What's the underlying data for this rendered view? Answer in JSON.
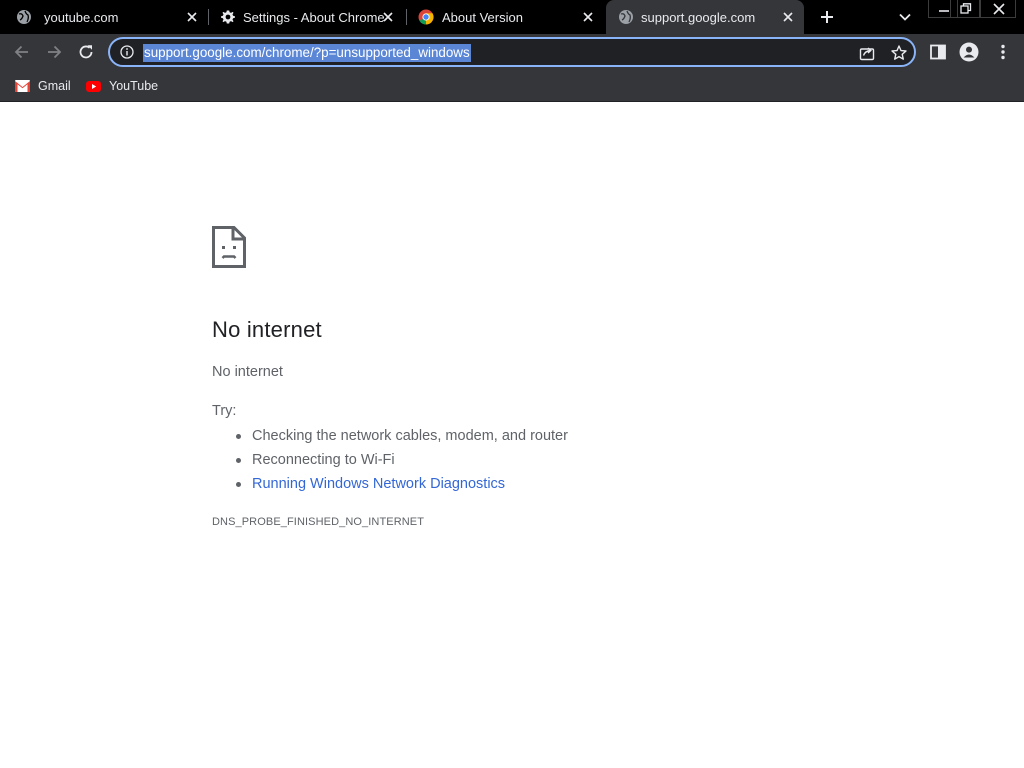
{
  "tabs": [
    {
      "title": "youtube.com",
      "favicon": "globe-icon",
      "active": false
    },
    {
      "title": "Settings - About Chrome",
      "favicon": "gear-icon",
      "active": false
    },
    {
      "title": "About Version",
      "favicon": "chrome-icon",
      "active": false
    },
    {
      "title": "support.google.com",
      "favicon": "globe-icon",
      "active": true
    }
  ],
  "omnibox": {
    "url": "support.google.com/chrome/?p=unsupported_windows"
  },
  "bookmarks": [
    {
      "label": "Gmail",
      "icon": "gmail-icon"
    },
    {
      "label": "YouTube",
      "icon": "youtube-icon"
    }
  ],
  "error_page": {
    "heading": "No internet",
    "subtitle": "No internet",
    "try_label": "Try:",
    "suggestions": [
      "Checking the network cables, modem, and router",
      "Reconnecting to Wi-Fi",
      "Running Windows Network Diagnostics"
    ],
    "error_code": "DNS_PROBE_FINISHED_NO_INTERNET"
  },
  "colors": {
    "tabstrip_bg": "#000000",
    "toolbar_bg": "#35363a",
    "omnibox_border": "#8ab4f8",
    "url_selection": "#5b86d6",
    "link": "#3367d6"
  }
}
